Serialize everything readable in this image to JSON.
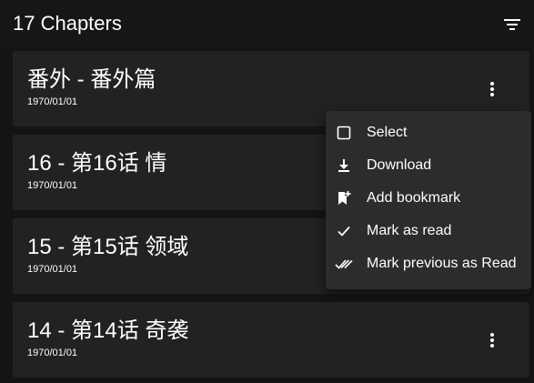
{
  "header": {
    "title": "17 Chapters",
    "filter_icon": "filter-list-icon"
  },
  "chapters": [
    {
      "title": "番外 - 番外篇",
      "date": "1970/01/01"
    },
    {
      "title": "16 - 第16话 情",
      "date": "1970/01/01"
    },
    {
      "title": "15 - 第15话 领域",
      "date": "1970/01/01"
    },
    {
      "title": "14 - 第14话 奇袭",
      "date": "1970/01/01"
    }
  ],
  "context_menu": {
    "items": [
      {
        "label": "Select",
        "icon": "checkbox-outline-icon"
      },
      {
        "label": "Download",
        "icon": "download-icon"
      },
      {
        "label": "Add bookmark",
        "icon": "bookmark-add-icon"
      },
      {
        "label": "Mark as read",
        "icon": "check-icon"
      },
      {
        "label": "Mark previous as Read",
        "icon": "double-check-icon"
      }
    ]
  },
  "colors": {
    "background": "#121212",
    "card": "#222222",
    "menu": "#2c2c2c",
    "text": "#ffffff"
  }
}
